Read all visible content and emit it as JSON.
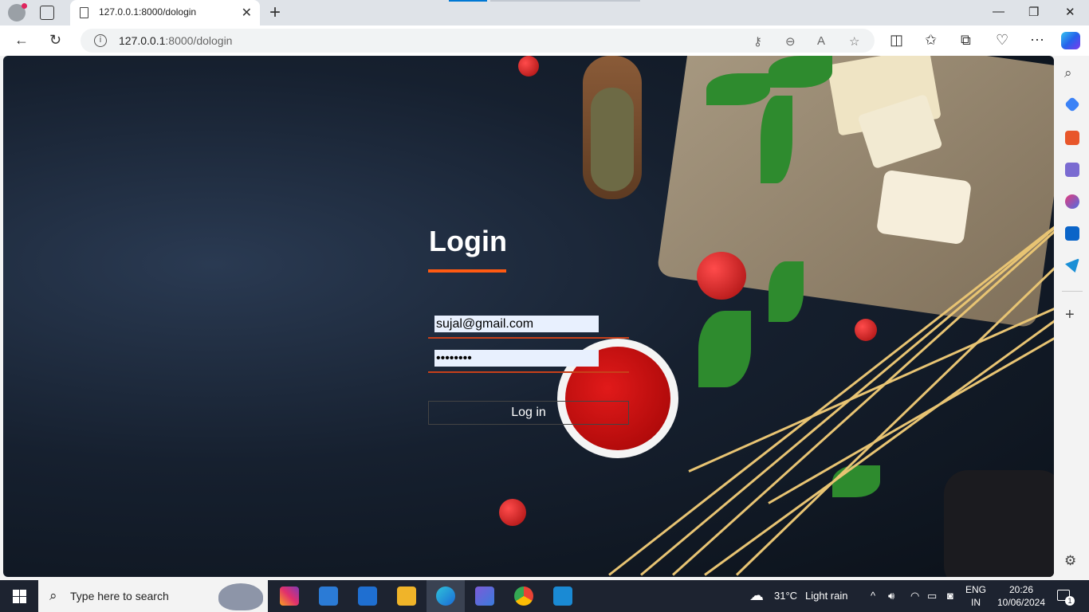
{
  "browser": {
    "tab_title": "127.0.0.1:8000/dologin",
    "url_host": "127.0.0.1",
    "url_path": ":8000/dologin",
    "new_tab_glyph": "+",
    "close_tab_glyph": "✕"
  },
  "window_controls": {
    "minimize": "—",
    "restore": "❐",
    "close": "✕"
  },
  "toolbar_icons": [
    "back-icon",
    "refresh-icon",
    "site-info-icon",
    "key-icon",
    "zoom-out-icon",
    "read-aloud-icon",
    "favorite-star-icon",
    "split-screen-icon",
    "favorites-icon",
    "collections-icon",
    "browser-essentials-icon",
    "more-icon",
    "copilot-icon"
  ],
  "login": {
    "title": "Login",
    "email_value": "sujal@gmail.com",
    "password_value": "••••••••",
    "button_label": "Log in",
    "accent_color": "#ff5a12"
  },
  "sidebar_icons": [
    "search-icon",
    "shopping-tag-icon",
    "toolbox-icon",
    "games-icon",
    "office-icon",
    "outlook-icon",
    "send-icon",
    "add-icon",
    "settings-icon"
  ],
  "taskbar": {
    "search_placeholder": "Type here to search",
    "apps": [
      "instagram-icon",
      "microsoft-store-icon",
      "mail-icon",
      "file-explorer-icon",
      "edge-icon",
      "copilot-app-icon",
      "chrome-icon",
      "vscode-icon"
    ],
    "weather_temp": "31°C",
    "weather_desc": "Light rain",
    "lang_top": "ENG",
    "lang_bottom": "IN",
    "time": "20:26",
    "date": "10/06/2024",
    "notification_count": "1"
  }
}
